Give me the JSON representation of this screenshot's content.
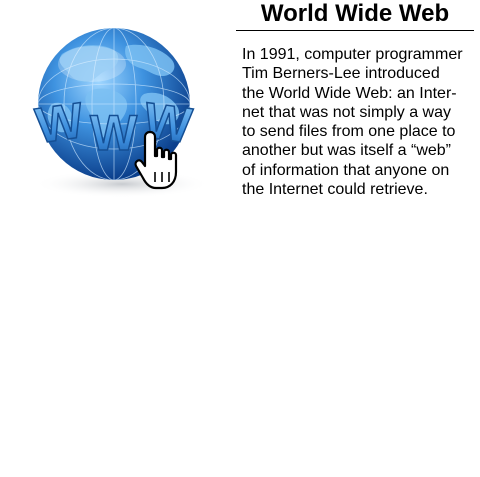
{
  "article": {
    "title": "World Wide Web",
    "body_lines": [
      "In 1991, computer programmer",
      "Tim Berners-Lee introduced",
      "the World Wide Web: an Inter-",
      "net that was not simply a way",
      "to send files from one place to",
      "another but was itself a “web”",
      "of information that anyone on",
      "the Internet could retrieve."
    ]
  },
  "illustration": {
    "letters": [
      "W",
      "W",
      "W"
    ],
    "globe_color": "#2f7fd4",
    "land_color": "#7cc0f2",
    "letter_color": "#5aa9e8",
    "cursor_icon": "hand-pointer-icon"
  }
}
